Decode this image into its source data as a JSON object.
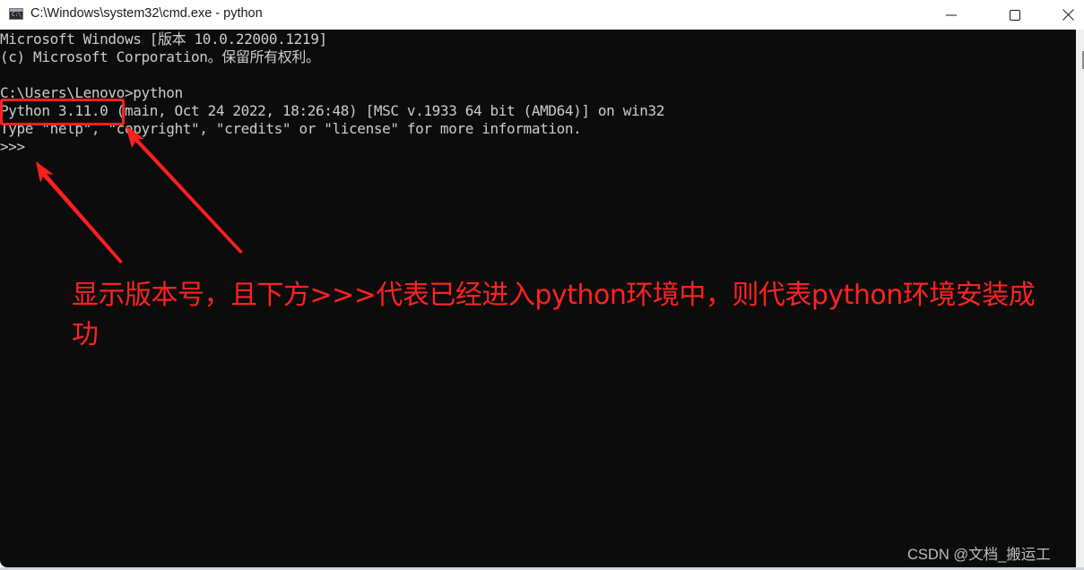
{
  "window": {
    "title": "C:\\Windows\\system32\\cmd.exe - python",
    "icon": "cmd-console-icon",
    "icon_glyph": "C:\\_",
    "controls": {
      "minimize": "minimize-icon",
      "maximize": "maximize-icon",
      "close": "close-icon"
    }
  },
  "console": {
    "lines": [
      "Microsoft Windows [版本 10.0.22000.1219]",
      "(c) Microsoft Corporation。保留所有权利。",
      "",
      "C:\\Users\\Lenovo>python",
      "Python 3.11.0 (main, Oct 24 2022, 18:26:48) [MSC v.1933 64 bit (AMD64)] on win32",
      "Type \"help\", \"copyright\", \"credits\" or \"license\" for more information.",
      ">>>"
    ],
    "colors": {
      "background": "#0c0c0c",
      "text": "#cccccc"
    }
  },
  "annotation": {
    "highlight_target": "Python 3.11.0",
    "text": "显示版本号，且下方>>>代表已经进入python环境中，则代表python环境安装成功",
    "color": "#ff2020"
  },
  "watermark": "CSDN @文档_搬运工"
}
